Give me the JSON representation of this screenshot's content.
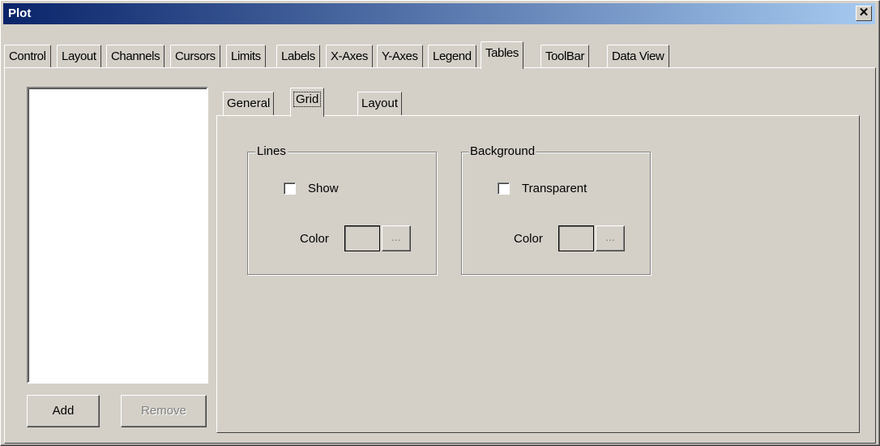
{
  "window": {
    "title": "Plot"
  },
  "tabs": [
    {
      "label": "Control"
    },
    {
      "label": "Layout"
    },
    {
      "label": "Channels"
    },
    {
      "label": "Cursors"
    },
    {
      "label": "Limits"
    },
    {
      "label": "Labels"
    },
    {
      "label": "X-Axes"
    },
    {
      "label": "Y-Axes"
    },
    {
      "label": "Legend"
    },
    {
      "label": "Tables"
    },
    {
      "label": "ToolBar"
    },
    {
      "label": "Data View"
    }
  ],
  "active_tab": "Tables",
  "list_buttons": {
    "add": "Add",
    "remove": "Remove"
  },
  "inner_tabs": [
    {
      "label": "General"
    },
    {
      "label": "Grid"
    },
    {
      "label": "Layout"
    }
  ],
  "active_inner_tab": "Grid",
  "lines_group": {
    "legend": "Lines",
    "show_label": "Show",
    "show_checked": false,
    "color_label": "Color",
    "browse": "..."
  },
  "background_group": {
    "legend": "Background",
    "transparent_label": "Transparent",
    "transparent_checked": false,
    "color_label": "Color",
    "browse": "..."
  },
  "colors": {
    "titlebar_start": "#0a246a",
    "titlebar_end": "#a6caf0",
    "face": "#d4d0c8"
  }
}
